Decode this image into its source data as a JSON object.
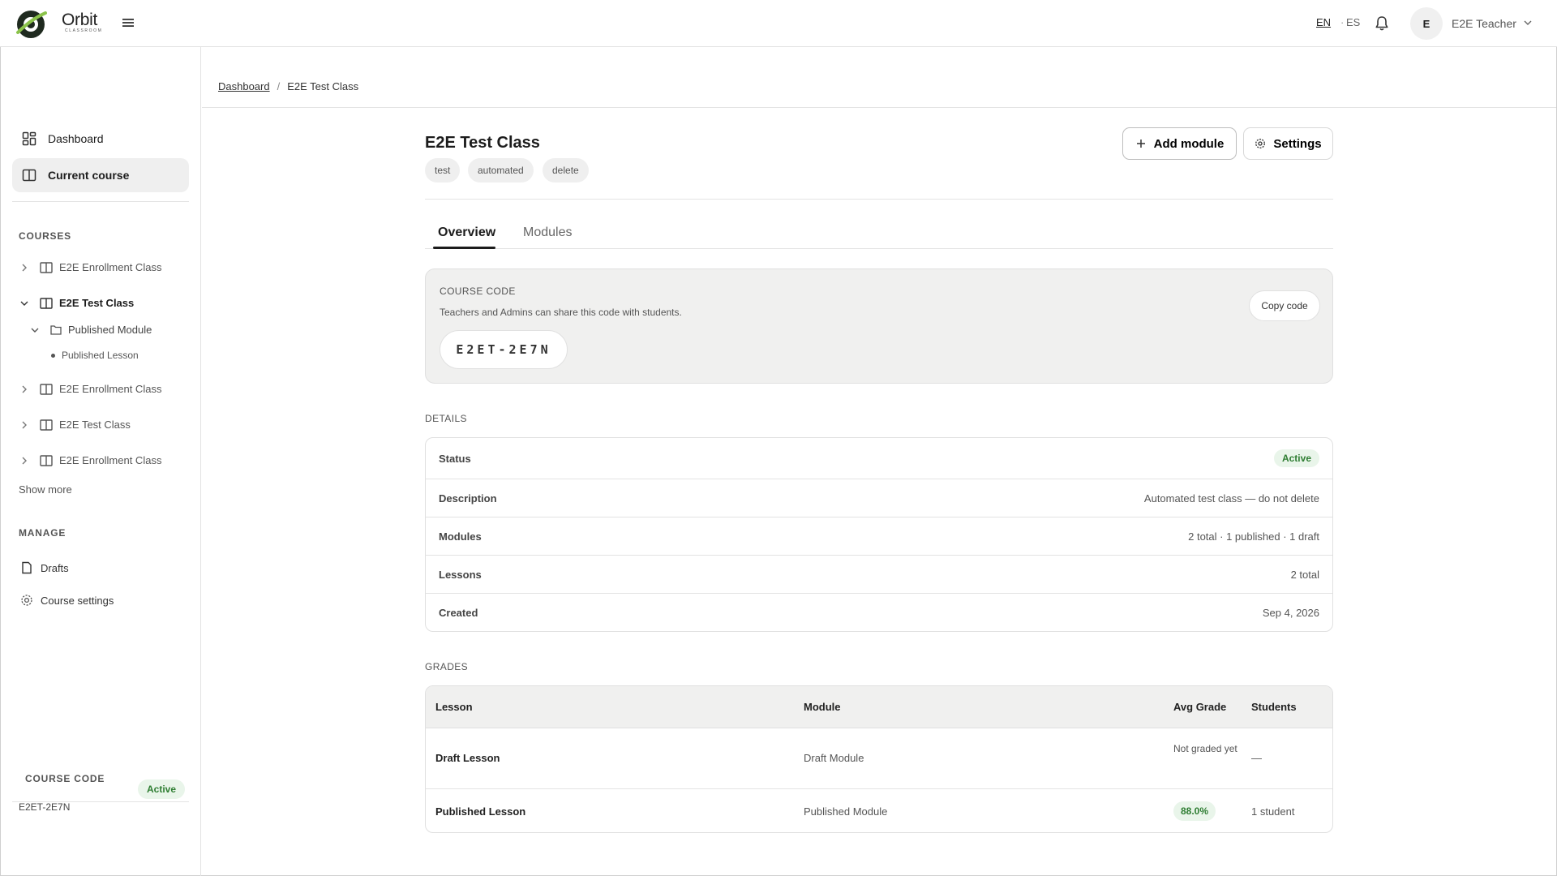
{
  "app": {
    "brand_name": "Orbit",
    "brand_sub": "CLASSROOM",
    "lang_en": "EN",
    "lang_sep": "·",
    "lang_es": "ES",
    "user_initial": "E",
    "user_name": "E2E Teacher"
  },
  "sidebar": {
    "nav": [
      {
        "label": "Dashboard",
        "icon": "dashboard-grid-icon"
      },
      {
        "label": "Current course",
        "icon": "book-open-icon"
      }
    ],
    "courses_heading": "COURSES",
    "courses": [
      {
        "label": "E2E Enrollment Class",
        "expanded": false
      },
      {
        "label": "E2E Test Class",
        "expanded": true
      },
      {
        "label": "E2E Enrollment Class",
        "expanded": false
      },
      {
        "label": "E2E Test Class",
        "expanded": false
      },
      {
        "label": "E2E Enrollment Class",
        "expanded": false
      }
    ],
    "module": "Published Module",
    "lesson": "Published Lesson",
    "show_more": "Show more",
    "manage_heading": "MANAGE",
    "manage": [
      {
        "label": "Drafts",
        "icon": "document-icon"
      },
      {
        "label": "Course settings",
        "icon": "gear-icon"
      }
    ],
    "footer": {
      "label": "COURSE CODE",
      "code": "E2ET-2E7N",
      "status": "Active"
    }
  },
  "breadcrumb": {
    "root": "Dashboard",
    "sep": "/",
    "current": "E2E Test Class"
  },
  "course": {
    "title": "E2E Test Class",
    "tags": [
      "test",
      "automated",
      "delete"
    ],
    "add_module": "Add module",
    "settings": "Settings",
    "tabs": [
      "Overview",
      "Modules"
    ]
  },
  "code_card": {
    "label": "COURSE CODE",
    "desc": "Teachers and Admins can share this code with students.",
    "code": "E2ET-2E7N",
    "copy": "Copy code"
  },
  "details": {
    "heading": "DETAILS",
    "rows": [
      {
        "key": "Status",
        "value": "Active"
      },
      {
        "key": "Description",
        "value": "Automated test class — do not delete"
      },
      {
        "key": "Modules",
        "value": "2 total · 1 published · 1 draft"
      },
      {
        "key": "Lessons",
        "value": "2 total"
      },
      {
        "key": "Created",
        "value": "Sep 4, 2026"
      }
    ]
  },
  "grades": {
    "heading": "GRADES",
    "columns": [
      "Lesson",
      "Module",
      "Avg Grade",
      "Students"
    ],
    "rows": [
      {
        "lesson": "Draft Lesson",
        "module": "Draft Module",
        "avg": "Not graded yet",
        "students": "—"
      },
      {
        "lesson": "Published Lesson",
        "module": "Published Module",
        "avg": "88.0%",
        "students": "1 student"
      }
    ]
  },
  "colors": {
    "accent_green": "#2e7d32",
    "badge_green_bg": "#e9f5ea",
    "logo_green": "#8bc34a"
  }
}
